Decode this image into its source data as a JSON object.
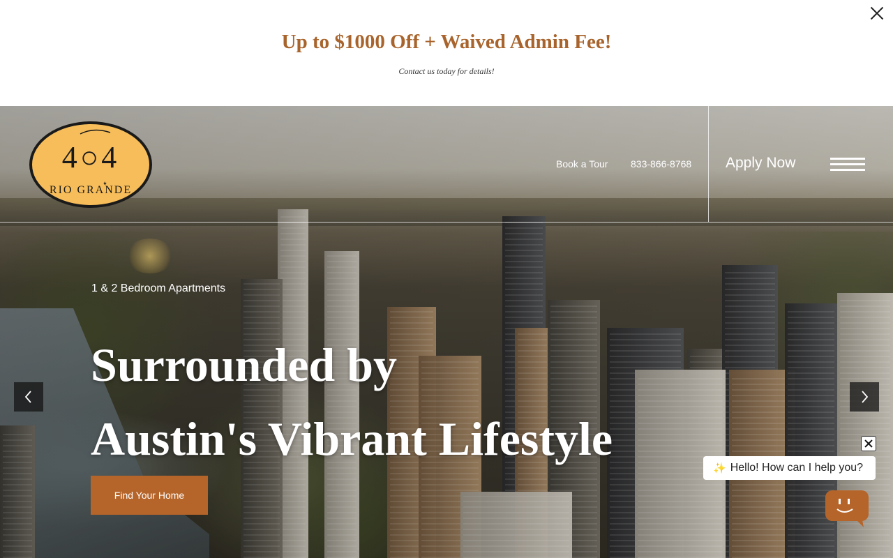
{
  "promo": {
    "title": "Up to $1000 Off + Waived Admin Fee!",
    "subtitle": "Contact us today for details!"
  },
  "header": {
    "logo_number": "4○4",
    "logo_name": "RIO GRANDE",
    "nav": {
      "book_tour": "Book a Tour",
      "phone": "833-866-8768",
      "apply": "Apply Now"
    }
  },
  "hero": {
    "kicker": "1 & 2 Bedroom Apartments",
    "headline_line1": "Surrounded by",
    "headline_line2": "Austin's Vibrant Lifestyle",
    "cta": "Find Your Home"
  },
  "chat": {
    "greeting": "Hello! How can I help you?"
  },
  "colors": {
    "brand_copper": "#b6652a",
    "promo_title": "#a8642c",
    "logo_gold": "#f7bd5a"
  },
  "icons": [
    "close-icon",
    "menu-icon",
    "chevron-left-icon",
    "chevron-right-icon",
    "sparkle-icon",
    "chatbot-icon"
  ]
}
